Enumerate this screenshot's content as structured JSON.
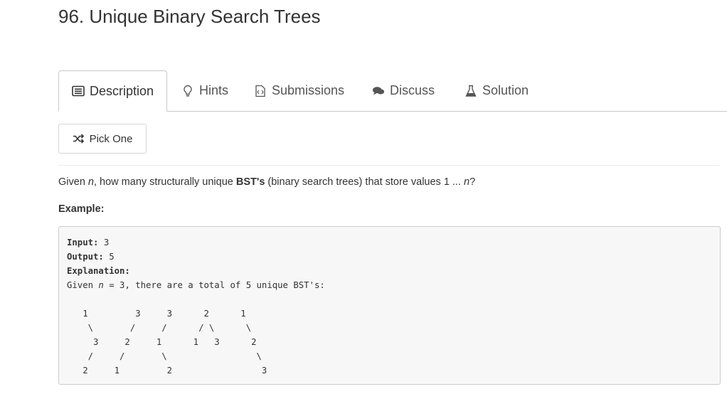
{
  "problem": {
    "title": "96. Unique Binary Search Trees"
  },
  "tabs": [
    {
      "label": "Description",
      "icon": "description-icon",
      "active": true
    },
    {
      "label": "Hints",
      "icon": "lightbulb-icon"
    },
    {
      "label": "Submissions",
      "icon": "code-file-icon"
    },
    {
      "label": "Discuss",
      "icon": "comments-icon"
    },
    {
      "label": "Solution",
      "icon": "flask-icon"
    }
  ],
  "pick_one": {
    "label": "Pick One",
    "icon": "shuffle-icon"
  },
  "question": {
    "prefix": "Given ",
    "n1": "n",
    "middle": ", how many structurally unique ",
    "bold": "BST's",
    "suffix": " (binary search trees) that store values 1 ... ",
    "n2": "n",
    "end": "?"
  },
  "example": {
    "label": "Example:",
    "input_label": "Input:",
    "input_value": " 3",
    "output_label": "Output:",
    "output_value": " 5",
    "explanation_label": "Explanation:",
    "given_prefix": "Given ",
    "given_n": "n",
    "given_suffix": " = 3, there are a total of 5 unique BST's:",
    "trees": "   1         3     3      2      1\n    \\       /     /      / \\      \\\n     3     2     1      1   3      2\n    /     /       \\                 \\\n   2     1         2                 3"
  }
}
